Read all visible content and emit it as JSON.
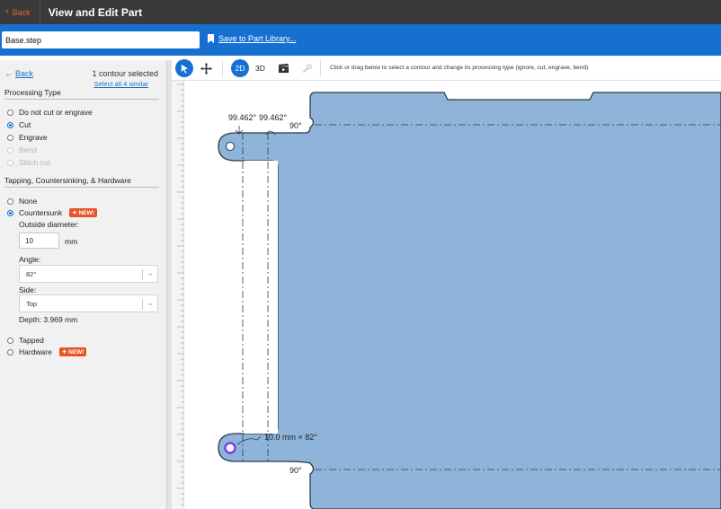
{
  "header": {
    "back_label": "Back",
    "title": "View and Edit Part"
  },
  "filebar": {
    "filename": "Base.step",
    "save_label": "Save to Part Library..."
  },
  "panel": {
    "back_label": "Back",
    "contour_count": "1 contour selected",
    "select_all": "Select all 4 similar",
    "processing_title": "Processing Type",
    "processing_options": [
      "Do not cut or engrave",
      "Cut",
      "Engrave",
      "Bend",
      "Stitch cut"
    ],
    "processing_selected": "Cut",
    "tapping_title": "Tapping, Countersinking, & Hardware",
    "none_label": "None",
    "countersunk_label": "Countersunk",
    "new_badge": "NEW!",
    "outside_diameter_label": "Outside diameter:",
    "outside_diameter_value": "10",
    "unit_mm": "mm",
    "angle_label": "Angle:",
    "angle_value": "82°",
    "side_label": "Side:",
    "side_value": "Top",
    "depth_text": "Depth: 3.969 mm",
    "tapped_label": "Tapped",
    "hardware_label": "Hardware"
  },
  "toolbar": {
    "mode_2d": "2D",
    "mode_3d": "3D",
    "hint": "Click or drag below to select a contour and change its processing type (ignore, cut, engrave, bend)"
  },
  "canvas": {
    "angle_left": "99.462°",
    "angle_right": "99.462°",
    "bend_top": "90°",
    "bend_bottom": "90°",
    "countersink_note": "10.0 mm × 82°"
  },
  "colors": {
    "accent": "#1670d2",
    "part_fill": "#8fb4d9",
    "badge": "#e8542a"
  },
  "icons": [
    "chevron-left-icon",
    "bookmark-icon",
    "arrow-left-icon",
    "pointer-icon",
    "move-icon",
    "clapperboard-icon",
    "wrench-icon"
  ]
}
